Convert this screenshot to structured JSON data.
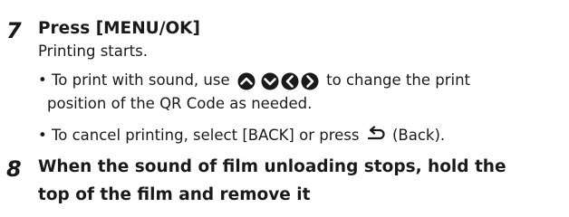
{
  "steps": [
    {
      "number": "7",
      "title": "Press [MENU/OK]",
      "intro": "Printing starts.",
      "bullets": [
        {
          "lead": "• To print with sound, use",
          "icons": [
            "up-arrow-icon",
            "down-arrow-icon",
            "left-arrow-icon",
            "right-arrow-icon"
          ],
          "tail": "to change the print",
          "continuation": "position of the QR Code as needed."
        },
        {
          "lead": "• To cancel printing, select [BACK] or press",
          "icon": "back-arrow-icon",
          "tail": "(Back)."
        }
      ]
    },
    {
      "number": "8",
      "title_line1": "When the sound of film unloading stops, hold the",
      "title_line2": "top of the film and remove it"
    }
  ],
  "colors": {
    "text": "#1a1a1a",
    "icon_fill": "#1a1a1a",
    "icon_glyph": "#ffffff"
  }
}
